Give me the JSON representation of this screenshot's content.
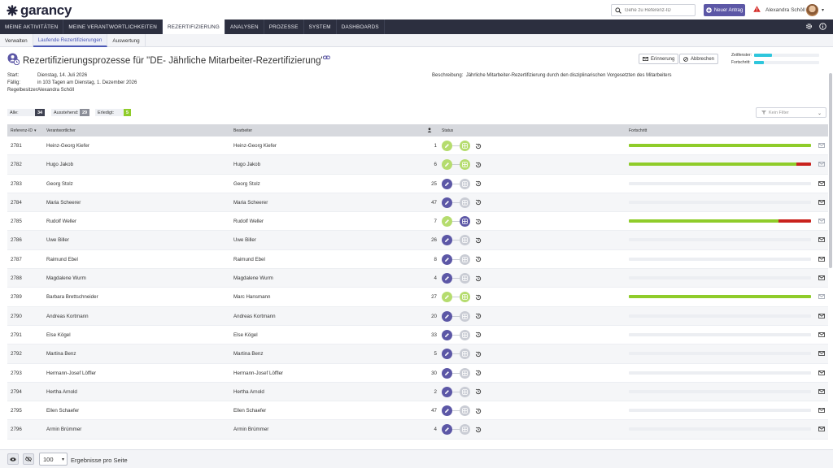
{
  "header": {
    "logo_text": "garancy",
    "search_placeholder": "Gehe zu Referenz-ID",
    "new_button_label": "Neuer Antrag",
    "user_name": "Alexandra Schöll"
  },
  "nav": {
    "items": [
      "MEINE AKTIVITÄTEN",
      "MEINE VERANTWORTLICHKEITEN",
      "REZERTIFIZIERUNG",
      "ANALYSEN",
      "PROZESSE",
      "SYSTEM",
      "DASHBOARDS"
    ],
    "active": "REZERTIFIZIERUNG"
  },
  "subnav": {
    "items": [
      "Verwalten",
      "Laufende Rezertifizierungen",
      "Auswertung"
    ],
    "active": "Laufende Rezertifizierungen"
  },
  "page": {
    "title": "Rezertifizierungsprozesse für \"DE- Jährliche Mitarbeiter-Rezertifizierung\"",
    "reminder_button": "Erinnerung",
    "cancel_button": "Abbrechen",
    "kpi": {
      "time_label": "Zeitfenster:",
      "time_fraction": 0.27,
      "progress_label": "Fortschritt:",
      "progress_fraction": 0.15
    },
    "meta": {
      "start_label": "Start:",
      "start_value": "Dienstag, 14. Juli 2026",
      "due_label": "Fällig:",
      "due_value": "in 103 Tagen am Dienstag, 1. Dezember 2026",
      "owner_label": "Regelbesitzer:",
      "owner_value": "Alexandra Schöll",
      "description_label": "Beschreibung:",
      "description_value": "Jährliche Mitarbeiter-Rezertifizierung durch den disziplinarischen Vorgesetzten des Mitarbeiters"
    }
  },
  "counters": {
    "all_label": "Alle:",
    "all_value": "34",
    "pending_label": "Ausstehend:",
    "pending_value": "29",
    "done_label": "Erledigt:",
    "done_value": "5"
  },
  "filter": {
    "placeholder": "Kein Filter"
  },
  "table": {
    "columns": [
      "Referenz-ID",
      "Verantwortlicher",
      "Bearbeiter",
      "",
      "Status",
      "Fortschritt"
    ],
    "rows": [
      {
        "id": "2781",
        "owner": "Heinz-Georg Kiefer",
        "editor": "Heinz-Georg Kiefer",
        "count": "1",
        "done": true,
        "grid_active": false,
        "green": 1.0,
        "red": 0
      },
      {
        "id": "2782",
        "owner": "Hugo Jakob",
        "editor": "Hugo Jakob",
        "count": "6",
        "done": true,
        "grid_active": false,
        "green": 0.92,
        "red": 0.08
      },
      {
        "id": "2783",
        "owner": "Georg Stolz",
        "editor": "Georg Stolz",
        "count": "25",
        "done": false,
        "grid_active": false,
        "green": 0,
        "red": 0
      },
      {
        "id": "2784",
        "owner": "Maria Scheerer",
        "editor": "Maria Scheerer",
        "count": "47",
        "done": false,
        "grid_active": false,
        "green": 0,
        "red": 0
      },
      {
        "id": "2785",
        "owner": "Rudolf Weller",
        "editor": "Rudolf Weller",
        "count": "7",
        "done": true,
        "grid_active": true,
        "green": 0.82,
        "red": 0.18
      },
      {
        "id": "2786",
        "owner": "Uwe Biller",
        "editor": "Uwe Biller",
        "count": "26",
        "done": false,
        "grid_active": false,
        "green": 0,
        "red": 0
      },
      {
        "id": "2787",
        "owner": "Raimund Ebel",
        "editor": "Raimund Ebel",
        "count": "8",
        "done": false,
        "grid_active": false,
        "green": 0,
        "red": 0
      },
      {
        "id": "2788",
        "owner": "Magdalene Wurm",
        "editor": "Magdalene Wurm",
        "count": "4",
        "done": false,
        "grid_active": false,
        "green": 0,
        "red": 0
      },
      {
        "id": "2789",
        "owner": "Barbara Brettschneider",
        "editor": "Marc Hansmann",
        "count": "27",
        "done": true,
        "grid_active": false,
        "green": 1.0,
        "red": 0
      },
      {
        "id": "2790",
        "owner": "Andreas Kortmann",
        "editor": "Andreas Kortmann",
        "count": "20",
        "done": false,
        "grid_active": false,
        "green": 0,
        "red": 0
      },
      {
        "id": "2791",
        "owner": "Else Kögel",
        "editor": "Else Kögel",
        "count": "33",
        "done": false,
        "grid_active": false,
        "green": 0,
        "red": 0
      },
      {
        "id": "2792",
        "owner": "Martina Benz",
        "editor": "Martina Benz",
        "count": "5",
        "done": false,
        "grid_active": false,
        "green": 0,
        "red": 0
      },
      {
        "id": "2793",
        "owner": "Hermann-Josef Löffler",
        "editor": "Hermann-Josef Löffler",
        "count": "30",
        "done": false,
        "grid_active": false,
        "green": 0,
        "red": 0
      },
      {
        "id": "2794",
        "owner": "Hertha Arnold",
        "editor": "Hertha Arnold",
        "count": "2",
        "done": false,
        "grid_active": false,
        "green": 0,
        "red": 0
      },
      {
        "id": "2795",
        "owner": "Ellen Schaefer",
        "editor": "Ellen Schaefer",
        "count": "47",
        "done": false,
        "grid_active": false,
        "green": 0,
        "red": 0
      },
      {
        "id": "2796",
        "owner": "Armin Brümmer",
        "editor": "Armin Brümmer",
        "count": "4",
        "done": false,
        "grid_active": false,
        "green": 0,
        "red": 0
      }
    ]
  },
  "footer": {
    "page_size": "100",
    "label": "Ergebnisse pro Seite"
  },
  "colors": {
    "accent": "#5c57a6",
    "green": "#8fcc2a",
    "red": "#c9221d",
    "cyan": "#2fc6dc",
    "nav_bg": "#2c2f3f"
  }
}
